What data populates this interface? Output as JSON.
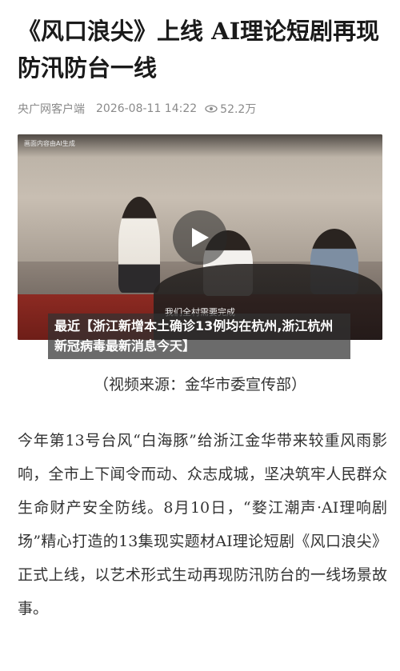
{
  "article": {
    "title": "《风口浪尖》上线 AI理论短剧再现防汛防台一线",
    "source": "央广网客户端",
    "date": "2026-08-11 14:22",
    "views": "52.2万",
    "video": {
      "watermark": "画面内容由AI生成",
      "subtitle": "我们全村需要完成"
    },
    "overlay_text": "最近【浙江新增本土确诊13例均在杭州,浙江杭州新冠病毒最新消息今天】",
    "video_source": "（视频来源：金华市委宣传部）",
    "body": "今年第13号台风“白海豚”给浙江金华带来较重风雨影响，全市上下闻令而动、众志成城，坚决筑牢人民群众生命财产安全防线。8月10日，“婺江潮声·AI理响剧场”精心打造的13集现实题材AI理论短剧《风口浪尖》正式上线，以艺术形式生动再现防汛防台的一线场景故事。"
  },
  "icons": {
    "views": "eye-icon",
    "play": "play-icon"
  }
}
